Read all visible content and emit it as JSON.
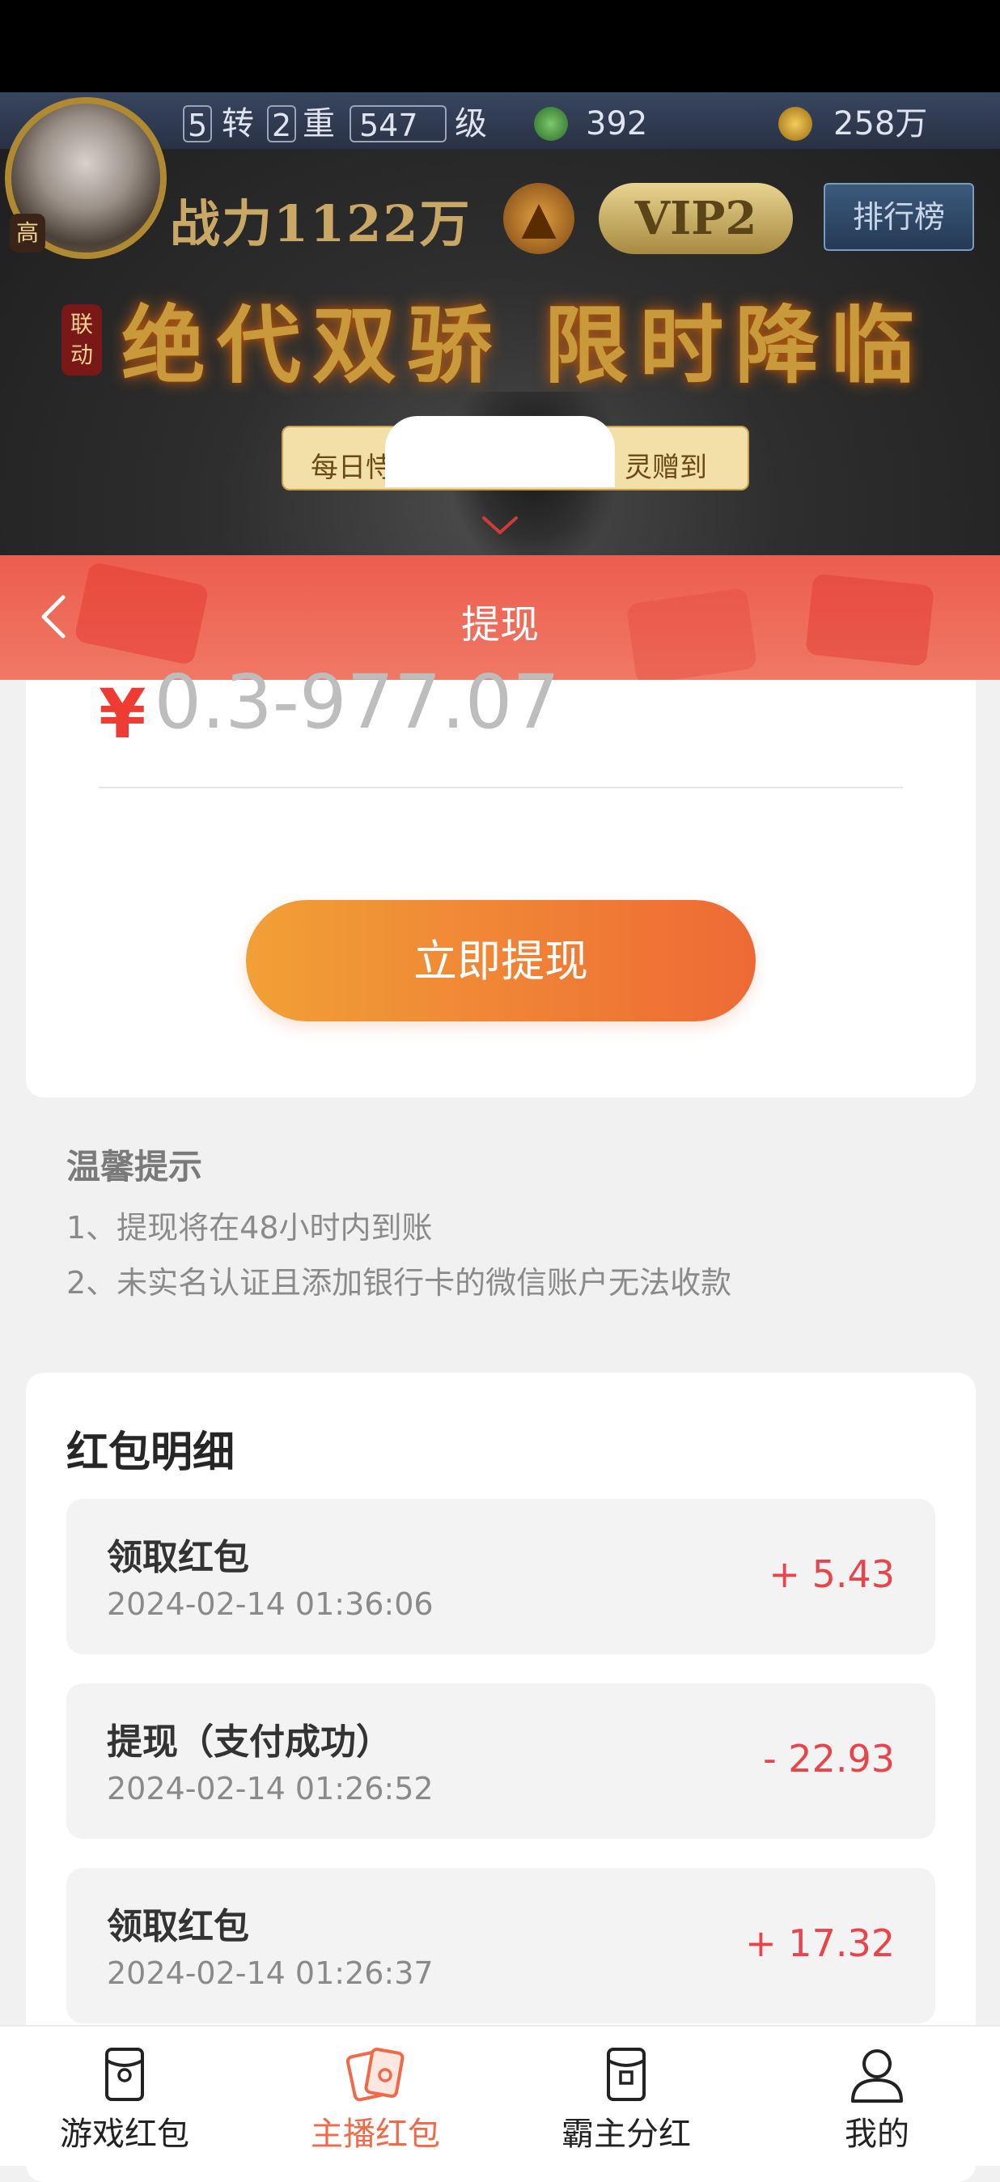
{
  "game_banner": {
    "level_a": "5",
    "level_a_unit": "转",
    "level_b": "2",
    "level_b_unit": "重",
    "level_c": "547",
    "level_c_unit": "级",
    "jade": "392",
    "gold": "258万",
    "badge_rank": "高",
    "power": "战力1122万",
    "vip": "VIP2",
    "leaderboard": "排行榜",
    "event_badge": "联动",
    "event_title": "绝代双骄 限时降临",
    "strip_left": "每日恃",
    "strip_right": "灵赠到"
  },
  "header": {
    "title": "提现"
  },
  "withdraw": {
    "currency": "¥",
    "amount_range": "0.3-977.07",
    "button_label": "立即提现"
  },
  "tips": {
    "title": "温馨提示",
    "items": [
      "1、提现将在48小时内到账",
      "2、未实名认证且添加银行卡的微信账户无法收款"
    ]
  },
  "records": {
    "title": "红包明细",
    "items": [
      {
        "title": "领取红包",
        "time": "2024-02-14 01:36:06",
        "amount": "+ 5.43"
      },
      {
        "title": "提现（支付成功）",
        "time": "2024-02-14 01:26:52",
        "amount": "- 22.93"
      },
      {
        "title": "领取红包",
        "time": "2024-02-14 01:26:37",
        "amount": "+ 17.32"
      }
    ]
  },
  "tabbar": {
    "active_color": "#f06a4a",
    "items": [
      {
        "label": "游戏红包",
        "icon": "game-redpacket-icon"
      },
      {
        "label": "主播红包",
        "icon": "streamer-redpacket-icon"
      },
      {
        "label": "霸主分红",
        "icon": "overlord-dividend-icon"
      },
      {
        "label": "我的",
        "icon": "user-icon"
      }
    ]
  }
}
